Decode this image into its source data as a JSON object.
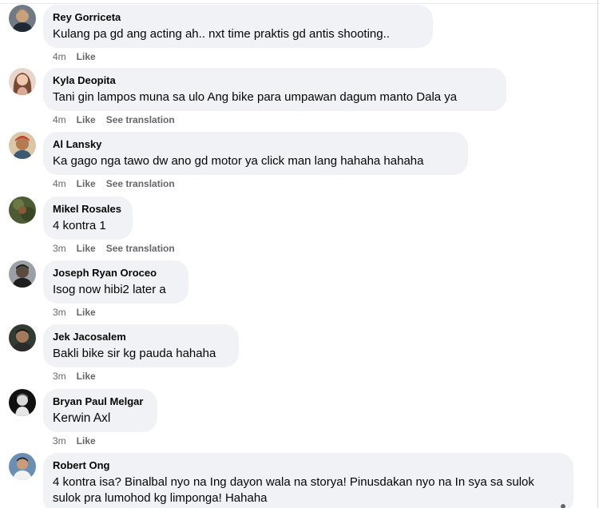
{
  "comments": [
    {
      "author": "Rey Gorriceta",
      "text": "Kulang pa gd ang acting ah.. nxt time praktis gd antis shooting..",
      "time": "4m",
      "like": "Like",
      "translate": ""
    },
    {
      "author": "Kyla Deopita",
      "text": "Tani gin lampos muna sa ulo Ang bike para umpawan dagum manto Dala ya",
      "time": "4m",
      "like": "Like",
      "translate": "See translation"
    },
    {
      "author": "Al Lansky",
      "text": "Ka gago nga tawo dw ano gd motor ya click man lang hahaha hahaha",
      "time": "4m",
      "like": "Like",
      "translate": "See translation"
    },
    {
      "author": "Mikel Rosales",
      "text": "4 kontra 1",
      "time": "3m",
      "like": "Like",
      "translate": "See translation"
    },
    {
      "author": "Joseph Ryan Oroceo",
      "text": "Isog now hibi2 later a",
      "time": "3m",
      "like": "Like",
      "translate": ""
    },
    {
      "author": "Jek Jacosalem",
      "text": "Bakli bike sir kg pauda hahaha",
      "time": "3m",
      "like": "Like",
      "translate": ""
    },
    {
      "author": "Bryan Paul Melgar",
      "text": "Kerwin Axl",
      "time": "3m",
      "like": "Like",
      "translate": ""
    },
    {
      "author": "Robert Ong",
      "text": "4 kontra isa? Binalbal nyo na Ing dayon wala na storya! Pinusdakan nyo na In sya sa sulok sulok pra lumohod kg limponga! Hahaha",
      "time": "",
      "like": "",
      "translate": ""
    }
  ],
  "colors": {
    "bubble": "#f0f2f5",
    "name": "#050505",
    "meta": "#65676b"
  },
  "icons": [
    "avatar"
  ]
}
